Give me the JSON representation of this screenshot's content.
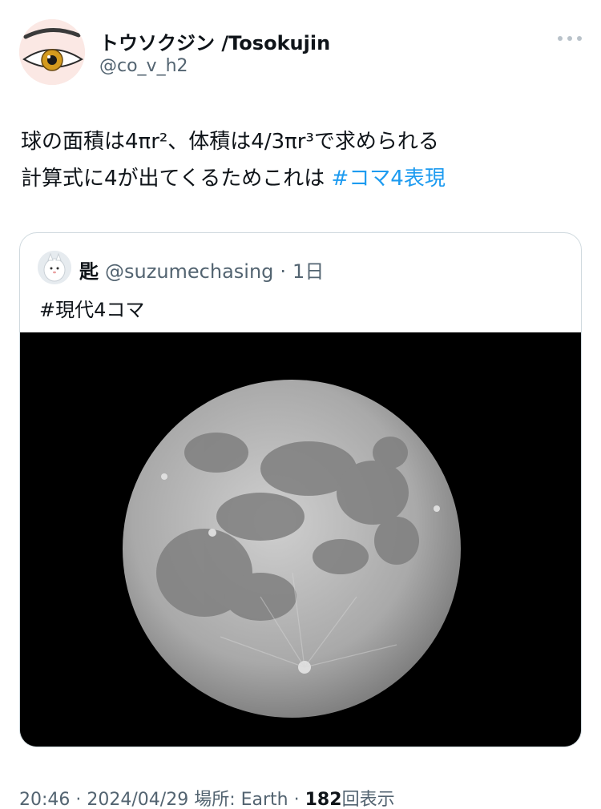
{
  "author": {
    "name": "トウソクジン /Tosokujin",
    "handle": "@co_v_h2",
    "avatar_icon": "eye-avatar-icon"
  },
  "more_icon": "more-options-icon",
  "tweet": {
    "line1": "球の面積は4πr²、体積は4/3πr³で求められる",
    "line2_prefix": "計算式に4が出てくるためこれは ",
    "hashtag": "#コマ4表現"
  },
  "quote": {
    "name": "匙",
    "handle": "@suzumechasing",
    "separator": "·",
    "time": "1日",
    "text": "#現代4コマ",
    "media_description_icon": "moon-photo"
  },
  "footer": {
    "time": "20:46",
    "sep1": "·",
    "date": "2024/04/29",
    "location_label": "場所: Earth",
    "sep2": "·",
    "view_count": "182",
    "view_label": "回表示"
  },
  "colors": {
    "link": "#1d9bf0",
    "secondary_text": "#536471",
    "border": "#cfd9de"
  }
}
